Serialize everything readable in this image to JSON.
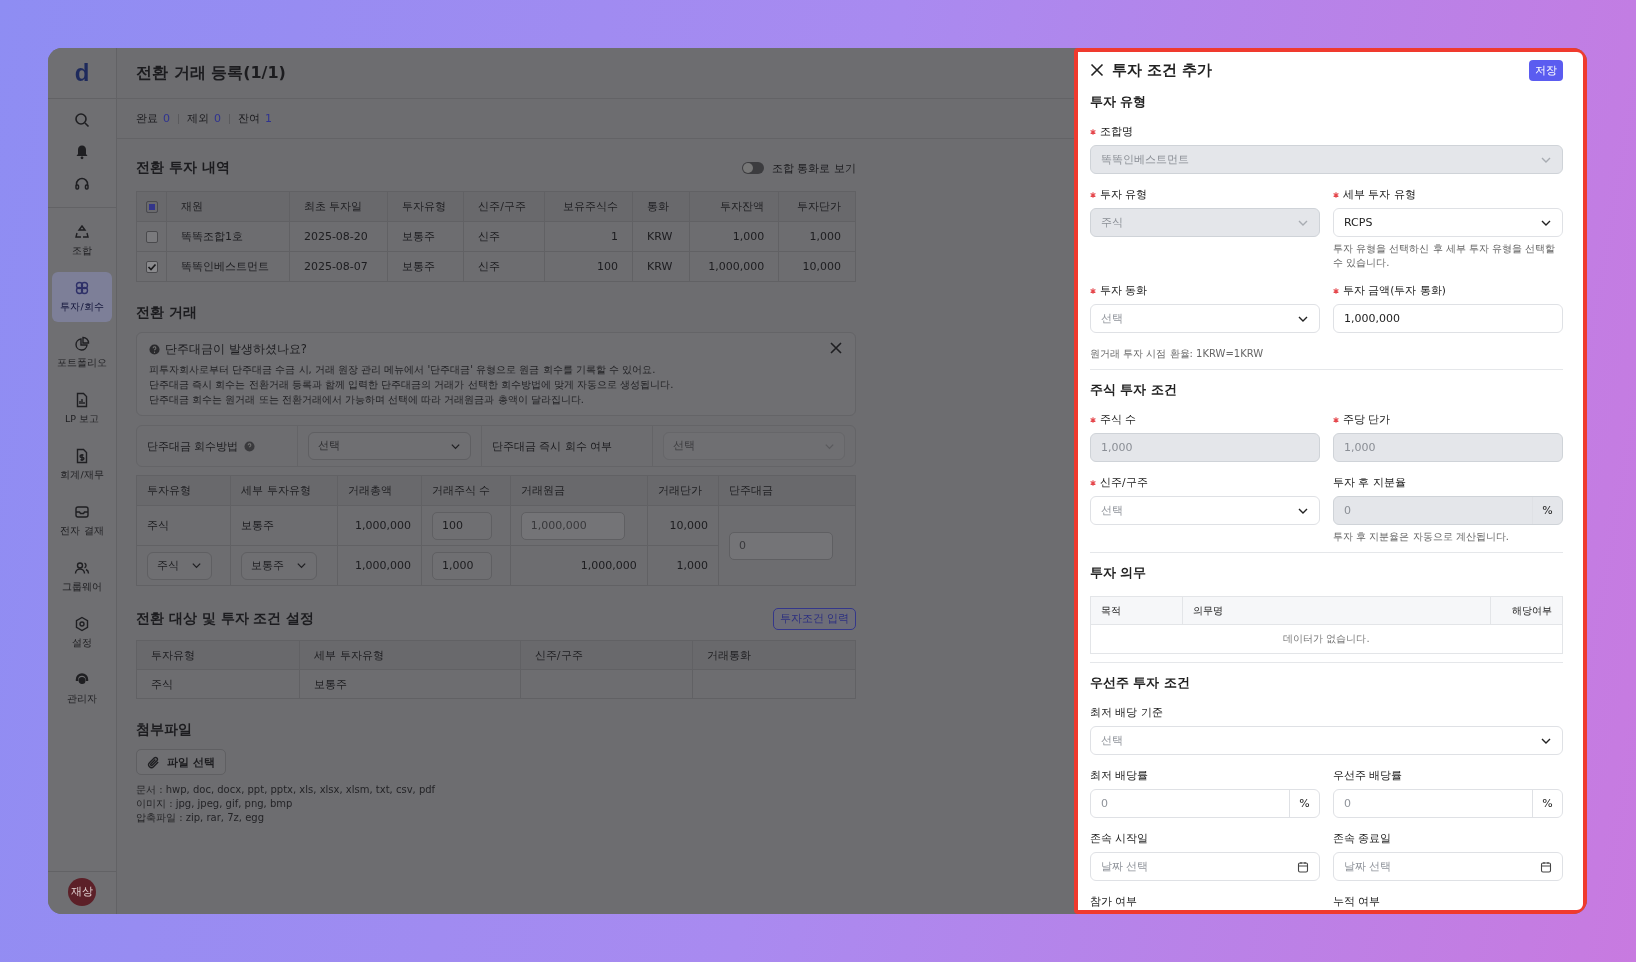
{
  "sidebar": {
    "logo": "d",
    "tools": [
      {
        "kind": "search"
      },
      {
        "kind": "bell"
      },
      {
        "kind": "headset"
      }
    ],
    "items": [
      {
        "kind": "fund",
        "label": "조합",
        "selected": false
      },
      {
        "kind": "invest",
        "label": "투자/회수",
        "selected": true
      },
      {
        "kind": "pie",
        "label": "포트폴리오",
        "selected": false
      },
      {
        "kind": "report",
        "label": "LP 보고",
        "selected": false
      },
      {
        "kind": "money",
        "label": "회계/재무",
        "selected": false
      },
      {
        "kind": "inbox",
        "label": "전자 결재",
        "selected": false
      },
      {
        "kind": "users",
        "label": "그룹웨어",
        "selected": false
      },
      {
        "kind": "gear",
        "label": "설정",
        "selected": false
      },
      {
        "kind": "admin",
        "label": "관리자",
        "selected": false
      }
    ],
    "avatar": "재상"
  },
  "page": {
    "title": "전환 거래 등록(1/1)",
    "stats": [
      {
        "label": "완료",
        "value": "0"
      },
      {
        "label": "제외",
        "value": "0"
      },
      {
        "label": "잔여",
        "value": "1"
      }
    ]
  },
  "holdings": {
    "title": "전환 투자 내역",
    "toggle": {
      "label": "조합 통화로 보기",
      "on": false
    },
    "indeterminate": true,
    "columns": [
      {
        "label": "재원",
        "kind": "text"
      },
      {
        "label": "최초 투자일",
        "kind": "text"
      },
      {
        "label": "투자유형",
        "kind": "text"
      },
      {
        "label": "신주/구주",
        "kind": "text"
      },
      {
        "label": "보유주식수",
        "kind": "number"
      },
      {
        "label": "통화",
        "kind": "text"
      },
      {
        "label": "투자잔액",
        "kind": "number"
      },
      {
        "label": "투자단가",
        "kind": "number"
      }
    ],
    "rows": [
      {
        "checked": false,
        "cells": [
          "똑똑조합1호",
          "2025-08-20",
          "보통주",
          "신주",
          "1",
          "KRW",
          "1,000",
          "1,000"
        ]
      },
      {
        "checked": true,
        "cells": [
          "똑똑인베스트먼트",
          "2025-08-07",
          "보통주",
          "신주",
          "100",
          "KRW",
          "1,000,000",
          "10,000"
        ]
      }
    ]
  },
  "trade": {
    "title": "전환 거래",
    "notice": {
      "title": "단주대금이 발생하셨나요?",
      "lines": [
        "피투자회사로부터 단주대금 수금 시, 거래 원장 관리 메뉴에서 '단주대금' 유형으로 원금 회수를 기록할 수 있어요.",
        "단주대금 즉시 회수는 전환거래 등록과 함께 입력한 단주대금의 거래가 선택한 회수방법에 맞게 자동으로 생성됩니다.",
        "단주대금 회수는 원거래 또는 전환거래에서 가능하며 선택에 따라 거래원금과 총액이 달라집니다."
      ]
    },
    "recovery": [
      {
        "label": "단주대금 회수방법",
        "help": true,
        "placeholder": "선택",
        "disabled": false
      },
      {
        "label": "단주대금 즉시 회수 여부",
        "help": false,
        "placeholder": "선택",
        "disabled": true
      }
    ],
    "columns": [
      "투자유형",
      "세부 투자유형",
      "거래총액",
      "거래주식 수",
      "거래원금",
      "거래단가",
      "단주대금"
    ],
    "rows": [
      {
        "cells": [
          {
            "kind": "text",
            "text": "주식"
          },
          {
            "kind": "text",
            "text": "보통주"
          },
          {
            "kind": "number",
            "text": "1,000,000"
          },
          {
            "kind": "input",
            "text": "100"
          },
          {
            "kind": "input_disabled",
            "text": "1,000,000"
          },
          {
            "kind": "number",
            "text": "10,000"
          }
        ]
      },
      {
        "cells": [
          {
            "kind": "select",
            "text": "주식"
          },
          {
            "kind": "select",
            "text": "보통주"
          },
          {
            "kind": "number",
            "text": "1,000,000"
          },
          {
            "kind": "input",
            "text": "1,000"
          },
          {
            "kind": "number",
            "text": "1,000,000"
          },
          {
            "kind": "number",
            "text": "1,000"
          }
        ]
      }
    ],
    "fraction": {
      "placeholder": "0"
    }
  },
  "targets": {
    "title": "전환 대상 및 투자 조건 설정",
    "button": "투자조건 입력",
    "columns": [
      "투자유형",
      "세부 투자유형",
      "신주/구주",
      "거래통화"
    ],
    "rows": [
      {
        "cells": [
          "주식",
          "보통주"
        ]
      }
    ]
  },
  "attachments": {
    "title": "첨부파일",
    "button": "파일 선택",
    "hints": [
      "문서 : hwp, doc, docx, ppt, pptx, xls, xlsx, xlsm, txt, csv, pdf",
      "이미지 : jpg, jpeg, gif, png, bmp",
      "압축파일 : zip, rar, 7z, egg"
    ]
  },
  "drawer": {
    "title": "투자 조건 추가",
    "save": "저장",
    "sections": [
      {
        "title": "투자 유형",
        "kind": "fields",
        "fields": [
          {
            "kind": "select",
            "label": "조합명",
            "required": true,
            "wide": true,
            "disabled": true,
            "value": "똑똑인베스트먼트"
          },
          {
            "kind": "select",
            "label": "투자 유형",
            "required": true,
            "wide": false,
            "disabled": true,
            "value": "주식"
          },
          {
            "kind": "select",
            "label": "세부 투자 유형",
            "required": true,
            "wide": false,
            "disabled": false,
            "value": "RCPS",
            "help": "투자 유형을 선택하신 후 세부 투자 유형을 선택할 수 있습니다."
          },
          {
            "kind": "select",
            "label": "투자 동화",
            "required": true,
            "wide": false,
            "disabled": false,
            "placeholder": "선택"
          },
          {
            "kind": "input",
            "label": "투자 금액(투자 통화)",
            "required": true,
            "wide": false,
            "disabled": false,
            "value": "1,000,000"
          },
          {
            "kind": "note",
            "text": "원거래 투자 시점 환율: 1KRW=1KRW"
          }
        ]
      },
      {
        "title": "주식 투자 조건",
        "kind": "fields",
        "fields": [
          {
            "kind": "input",
            "label": "주식 수",
            "required": true,
            "wide": false,
            "disabled": true,
            "value": "1,000"
          },
          {
            "kind": "input",
            "label": "주당 단가",
            "required": true,
            "wide": false,
            "disabled": true,
            "value": "1,000"
          },
          {
            "kind": "select",
            "label": "신주/구주",
            "required": true,
            "wide": false,
            "disabled": false,
            "placeholder": "선택"
          },
          {
            "kind": "input",
            "label": "투자 후 지분율",
            "required": false,
            "wide": false,
            "disabled": true,
            "placeholder": "0",
            "suffix": "%",
            "help": "투자 후 지분율은 자동으로 계산됩니다."
          }
        ]
      },
      {
        "title": "투자 의무",
        "kind": "table",
        "columns": [
          "목적",
          "의무명",
          "해당여부"
        ],
        "empty": "데이터가 없습니다."
      },
      {
        "title": "우선주 투자 조건",
        "kind": "fields",
        "fields": [
          {
            "kind": "select",
            "label": "최저 배당 기준",
            "required": false,
            "wide": true,
            "disabled": false,
            "placeholder": "선택"
          },
          {
            "kind": "input",
            "label": "최저 배당률",
            "required": false,
            "wide": false,
            "disabled": false,
            "placeholder": "0",
            "suffix": "%"
          },
          {
            "kind": "input",
            "label": "우선주 배당률",
            "required": false,
            "wide": false,
            "disabled": false,
            "placeholder": "0",
            "suffix": "%"
          },
          {
            "kind": "date",
            "label": "존속 시작일",
            "required": false,
            "wide": false,
            "disabled": false,
            "placeholder": "날짜 선택"
          },
          {
            "kind": "date",
            "label": "존속 종료일",
            "required": false,
            "wide": false,
            "disabled": false,
            "placeholder": "날짜 선택"
          },
          {
            "kind": "label",
            "label": "참가 여부",
            "required": false
          },
          {
            "kind": "label",
            "label": "누적 여부",
            "required": false
          }
        ]
      }
    ]
  }
}
